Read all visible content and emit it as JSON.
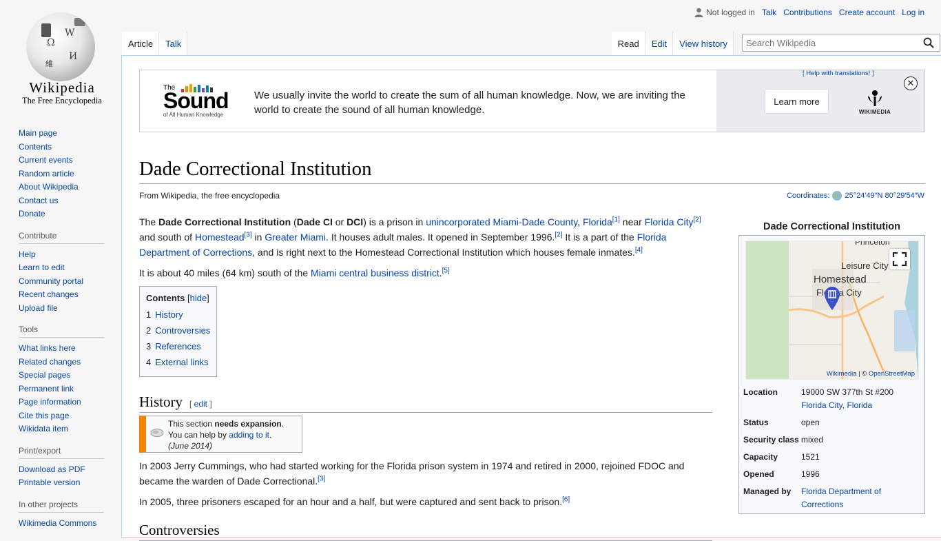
{
  "logo": {
    "wordmark": "Wikipedia",
    "tagline": "The Free Encyclopedia",
    "glyphs": [
      "Ω",
      "W",
      "維",
      "И"
    ]
  },
  "personal": {
    "not_logged_in": "Not logged in",
    "links": [
      "Talk",
      "Contributions",
      "Create account",
      "Log in"
    ]
  },
  "tabs": {
    "left": [
      {
        "label": "Article",
        "selected": true
      },
      {
        "label": "Talk",
        "selected": false
      }
    ],
    "right": [
      {
        "label": "Read",
        "selected": true
      },
      {
        "label": "Edit",
        "selected": false
      },
      {
        "label": "View history",
        "selected": false
      }
    ]
  },
  "search": {
    "placeholder": "Search Wikipedia"
  },
  "sidebar": {
    "main": [
      "Main page",
      "Contents",
      "Current events",
      "Random article",
      "About Wikipedia",
      "Contact us",
      "Donate"
    ],
    "contribute": {
      "heading": "Contribute",
      "items": [
        "Help",
        "Learn to edit",
        "Community portal",
        "Recent changes",
        "Upload file"
      ]
    },
    "tools": {
      "heading": "Tools",
      "items": [
        "What links here",
        "Related changes",
        "Special pages",
        "Permanent link",
        "Page information",
        "Cite this page",
        "Wikidata item"
      ]
    },
    "print": {
      "heading": "Print/export",
      "items": [
        "Download as PDF",
        "Printable version"
      ]
    },
    "projects": {
      "heading": "In other projects",
      "items": [
        "Wikimedia Commons"
      ]
    }
  },
  "banner": {
    "logo_the": "The",
    "logo_word": "Sound",
    "logo_sub": "of All Human Knowledge",
    "text": "We usually invite the world to create the sum of all human knowledge. Now, we are inviting the world to create the sound of all human knowledge.",
    "help_translations": "[ Help with translations! ]",
    "learn_more": "Learn more",
    "wikimedia": "WIKIMEDIA",
    "close": "✕"
  },
  "article": {
    "title": "Dade Correctional Institution",
    "from": "From Wikipedia, the free encyclopedia",
    "coordinates_label": "Coordinates:",
    "coordinates_value": "25°24′49″N 80°29′54″W",
    "p1": {
      "t1": "The ",
      "b1": "Dade Correctional Institution",
      "t2": " (",
      "b2": "Dade CI",
      "t3": " or ",
      "b3": "DCI",
      "t4": ") is a prison in ",
      "l1": "unincorporated Miami-Dade County",
      "t5": ", ",
      "l2": "Florida",
      "r1": "[1]",
      "t6": " near ",
      "l3": "Florida City",
      "r2": "[2]",
      "t7": " and south of ",
      "l4": "Homestead",
      "r3": "[3]",
      "t8": " in ",
      "l5": "Greater Miami",
      "t9": ". It houses adult males. It opened in September 1996.",
      "r4": "[2]",
      "t10": " It is a part of the ",
      "l6": "Florida Department of Corrections",
      "t11": ", and is right next to the Homestead Correctional Institution which houses female inmates.",
      "r5": "[4]"
    },
    "p2": {
      "t1": "It is about 40 miles (64 km) south of the ",
      "l1": "Miami central business district",
      "t2": ".",
      "r1": "[5]"
    },
    "toc": {
      "title": "Contents",
      "hide": "hide",
      "items": [
        {
          "num": "1",
          "label": "History"
        },
        {
          "num": "2",
          "label": "Controversies"
        },
        {
          "num": "3",
          "label": "References"
        },
        {
          "num": "4",
          "label": "External links"
        }
      ]
    },
    "history": {
      "heading": "History",
      "edit": "edit",
      "ambox": {
        "t1": "This section ",
        "b1": "needs expansion",
        "t2": ".",
        "t3": "You can help by ",
        "l1": "adding to it",
        "t4": ".",
        "date": "(June 2014)"
      },
      "p1": {
        "t1": "In 2003 Jerry Cummings, who had started working for the Florida prison system in 1974 and retired in 2000, rejoined FDOC and became the warden of Dade Correctional.",
        "r1": "[3]"
      },
      "p2": {
        "t1": "In 2005, three prisoners escaped for an hour and a half, but were captured and sent back to prison.",
        "r1": "[6]"
      }
    },
    "next_heading": "Controversies"
  },
  "infobox": {
    "caption": "Dade Correctional Institution",
    "map_labels": [
      "Princeton",
      "Leisure City",
      "Homestead",
      "Florida City"
    ],
    "map_attribution": {
      "a": "Wikimedia",
      "sep": " | © ",
      "b": "OpenStreetMap"
    },
    "rows": [
      {
        "key": "Location",
        "value": "19000 SW 377th St #200",
        "link": "Florida City, Florida"
      },
      {
        "key": "Status",
        "value": "open"
      },
      {
        "key": "Security class",
        "value": "mixed"
      },
      {
        "key": "Capacity",
        "value": "1521"
      },
      {
        "key": "Opened",
        "value": "1996"
      },
      {
        "key": "Managed by",
        "link": "Florida Department of Corrections"
      }
    ]
  },
  "colors": {
    "link": "#0645ad",
    "accent_orange": "#f28500",
    "border": "#a7d7f9"
  }
}
